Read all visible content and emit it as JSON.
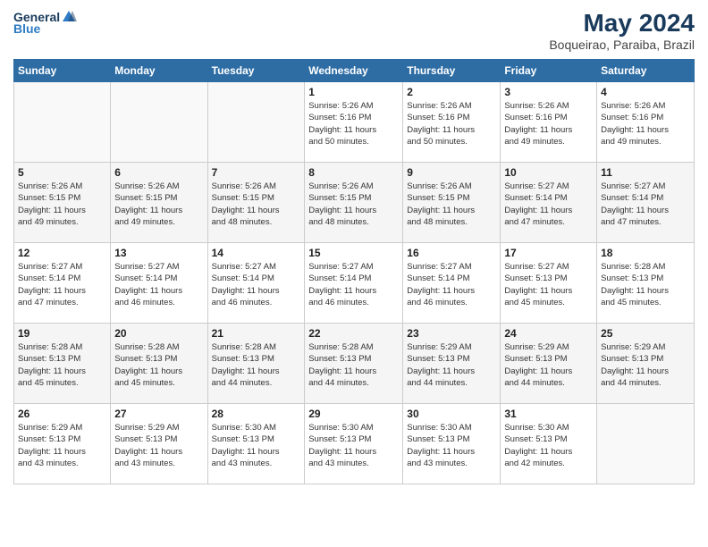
{
  "header": {
    "logo_general": "General",
    "logo_blue": "Blue",
    "title": "May 2024",
    "subtitle": "Boqueirao, Paraiba, Brazil"
  },
  "calendar": {
    "days_of_week": [
      "Sunday",
      "Monday",
      "Tuesday",
      "Wednesday",
      "Thursday",
      "Friday",
      "Saturday"
    ],
    "weeks": [
      [
        {
          "day": "",
          "info": ""
        },
        {
          "day": "",
          "info": ""
        },
        {
          "day": "",
          "info": ""
        },
        {
          "day": "1",
          "info": "Sunrise: 5:26 AM\nSunset: 5:16 PM\nDaylight: 11 hours\nand 50 minutes."
        },
        {
          "day": "2",
          "info": "Sunrise: 5:26 AM\nSunset: 5:16 PM\nDaylight: 11 hours\nand 50 minutes."
        },
        {
          "day": "3",
          "info": "Sunrise: 5:26 AM\nSunset: 5:16 PM\nDaylight: 11 hours\nand 49 minutes."
        },
        {
          "day": "4",
          "info": "Sunrise: 5:26 AM\nSunset: 5:16 PM\nDaylight: 11 hours\nand 49 minutes."
        }
      ],
      [
        {
          "day": "5",
          "info": "Sunrise: 5:26 AM\nSunset: 5:15 PM\nDaylight: 11 hours\nand 49 minutes."
        },
        {
          "day": "6",
          "info": "Sunrise: 5:26 AM\nSunset: 5:15 PM\nDaylight: 11 hours\nand 49 minutes."
        },
        {
          "day": "7",
          "info": "Sunrise: 5:26 AM\nSunset: 5:15 PM\nDaylight: 11 hours\nand 48 minutes."
        },
        {
          "day": "8",
          "info": "Sunrise: 5:26 AM\nSunset: 5:15 PM\nDaylight: 11 hours\nand 48 minutes."
        },
        {
          "day": "9",
          "info": "Sunrise: 5:26 AM\nSunset: 5:15 PM\nDaylight: 11 hours\nand 48 minutes."
        },
        {
          "day": "10",
          "info": "Sunrise: 5:27 AM\nSunset: 5:14 PM\nDaylight: 11 hours\nand 47 minutes."
        },
        {
          "day": "11",
          "info": "Sunrise: 5:27 AM\nSunset: 5:14 PM\nDaylight: 11 hours\nand 47 minutes."
        }
      ],
      [
        {
          "day": "12",
          "info": "Sunrise: 5:27 AM\nSunset: 5:14 PM\nDaylight: 11 hours\nand 47 minutes."
        },
        {
          "day": "13",
          "info": "Sunrise: 5:27 AM\nSunset: 5:14 PM\nDaylight: 11 hours\nand 46 minutes."
        },
        {
          "day": "14",
          "info": "Sunrise: 5:27 AM\nSunset: 5:14 PM\nDaylight: 11 hours\nand 46 minutes."
        },
        {
          "day": "15",
          "info": "Sunrise: 5:27 AM\nSunset: 5:14 PM\nDaylight: 11 hours\nand 46 minutes."
        },
        {
          "day": "16",
          "info": "Sunrise: 5:27 AM\nSunset: 5:14 PM\nDaylight: 11 hours\nand 46 minutes."
        },
        {
          "day": "17",
          "info": "Sunrise: 5:27 AM\nSunset: 5:13 PM\nDaylight: 11 hours\nand 45 minutes."
        },
        {
          "day": "18",
          "info": "Sunrise: 5:28 AM\nSunset: 5:13 PM\nDaylight: 11 hours\nand 45 minutes."
        }
      ],
      [
        {
          "day": "19",
          "info": "Sunrise: 5:28 AM\nSunset: 5:13 PM\nDaylight: 11 hours\nand 45 minutes."
        },
        {
          "day": "20",
          "info": "Sunrise: 5:28 AM\nSunset: 5:13 PM\nDaylight: 11 hours\nand 45 minutes."
        },
        {
          "day": "21",
          "info": "Sunrise: 5:28 AM\nSunset: 5:13 PM\nDaylight: 11 hours\nand 44 minutes."
        },
        {
          "day": "22",
          "info": "Sunrise: 5:28 AM\nSunset: 5:13 PM\nDaylight: 11 hours\nand 44 minutes."
        },
        {
          "day": "23",
          "info": "Sunrise: 5:29 AM\nSunset: 5:13 PM\nDaylight: 11 hours\nand 44 minutes."
        },
        {
          "day": "24",
          "info": "Sunrise: 5:29 AM\nSunset: 5:13 PM\nDaylight: 11 hours\nand 44 minutes."
        },
        {
          "day": "25",
          "info": "Sunrise: 5:29 AM\nSunset: 5:13 PM\nDaylight: 11 hours\nand 44 minutes."
        }
      ],
      [
        {
          "day": "26",
          "info": "Sunrise: 5:29 AM\nSunset: 5:13 PM\nDaylight: 11 hours\nand 43 minutes."
        },
        {
          "day": "27",
          "info": "Sunrise: 5:29 AM\nSunset: 5:13 PM\nDaylight: 11 hours\nand 43 minutes."
        },
        {
          "day": "28",
          "info": "Sunrise: 5:30 AM\nSunset: 5:13 PM\nDaylight: 11 hours\nand 43 minutes."
        },
        {
          "day": "29",
          "info": "Sunrise: 5:30 AM\nSunset: 5:13 PM\nDaylight: 11 hours\nand 43 minutes."
        },
        {
          "day": "30",
          "info": "Sunrise: 5:30 AM\nSunset: 5:13 PM\nDaylight: 11 hours\nand 43 minutes."
        },
        {
          "day": "31",
          "info": "Sunrise: 5:30 AM\nSunset: 5:13 PM\nDaylight: 11 hours\nand 42 minutes."
        },
        {
          "day": "",
          "info": ""
        }
      ]
    ]
  }
}
